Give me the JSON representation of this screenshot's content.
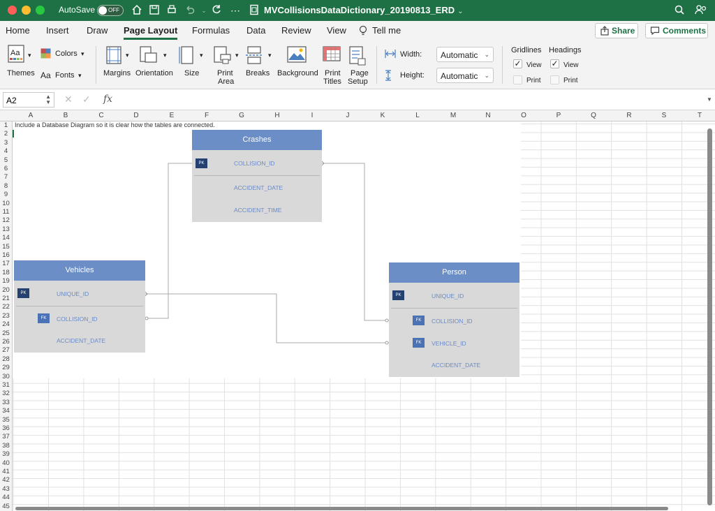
{
  "titlebar": {
    "autosave_label": "AutoSave",
    "toggle_state": "OFF",
    "document_title": "MVCollisionsDataDictionary_20190813_ERD"
  },
  "tabs": [
    "Home",
    "Insert",
    "Draw",
    "Page Layout",
    "Formulas",
    "Data",
    "Review",
    "View",
    "Tell me"
  ],
  "active_tab": "Page Layout",
  "share_label": "Share",
  "comments_label": "Comments",
  "ribbon": {
    "themes": "Themes",
    "colors": "Colors",
    "fonts": "Fonts",
    "margins": "Margins",
    "orientation": "Orientation",
    "size": "Size",
    "print_area_1": "Print",
    "print_area_2": "Area",
    "breaks": "Breaks",
    "background": "Background",
    "print_titles_1": "Print",
    "print_titles_2": "Titles",
    "page_setup_1": "Page",
    "page_setup_2": "Setup",
    "width_label": "Width:",
    "width_value": "Automatic",
    "height_label": "Height:",
    "height_value": "Automatic",
    "gridlines": "Gridlines",
    "gridlines_view": "View",
    "gridlines_print": "Print",
    "headings": "Headings",
    "headings_view": "View",
    "headings_print": "Print"
  },
  "formula_bar": {
    "name_box": "A2",
    "fx": "fx",
    "formula": ""
  },
  "columns": [
    "A",
    "B",
    "C",
    "D",
    "E",
    "F",
    "G",
    "H",
    "I",
    "J",
    "K",
    "L",
    "M",
    "N",
    "O",
    "P",
    "Q",
    "R",
    "S",
    "T"
  ],
  "rows": [
    "1",
    "2",
    "3",
    "4",
    "5",
    "6",
    "7",
    "8",
    "9",
    "10",
    "11",
    "12",
    "13",
    "14",
    "15",
    "16",
    "17",
    "18",
    "19",
    "20",
    "21",
    "22",
    "23",
    "24",
    "25",
    "26",
    "27",
    "28",
    "29",
    "30",
    "31",
    "32",
    "33",
    "34",
    "35",
    "36",
    "37",
    "38",
    "39",
    "40",
    "41",
    "42",
    "43",
    "44",
    "45"
  ],
  "cell_a1": "Include a Database Diagram so it is clear how the tables are connected.",
  "erd": {
    "crashes": {
      "title": "Crashes",
      "pk_tag": "PK",
      "pk_field": "COLLISION_ID",
      "field_1": "ACCIDENT_DATE",
      "field_2": "ACCIDENT_TIME"
    },
    "vehicles": {
      "title": "Vehicles",
      "pk_tag": "PK",
      "pk_field": "UNIQUE_ID",
      "fk_tag": "FK",
      "fk_field": "COLLISION_ID",
      "field_1": "ACCIDENT_DATE"
    },
    "person": {
      "title": "Person",
      "pk_tag": "PK",
      "pk_field": "UNIQUE_ID",
      "fk1_tag": "FK",
      "fk1_field": "COLLISION_ID",
      "fk2_tag": "FK",
      "fk2_field": "VEHICLE_ID",
      "field_1": "ACCIDENT_DATE"
    }
  },
  "colors": {
    "titlebar": "#1e7145",
    "entity_header": "#6b8ec7",
    "entity_body": "#d9d9d9",
    "pk": "#24416f",
    "fk": "#4a72b5",
    "field_text": "#6a8ac5"
  }
}
